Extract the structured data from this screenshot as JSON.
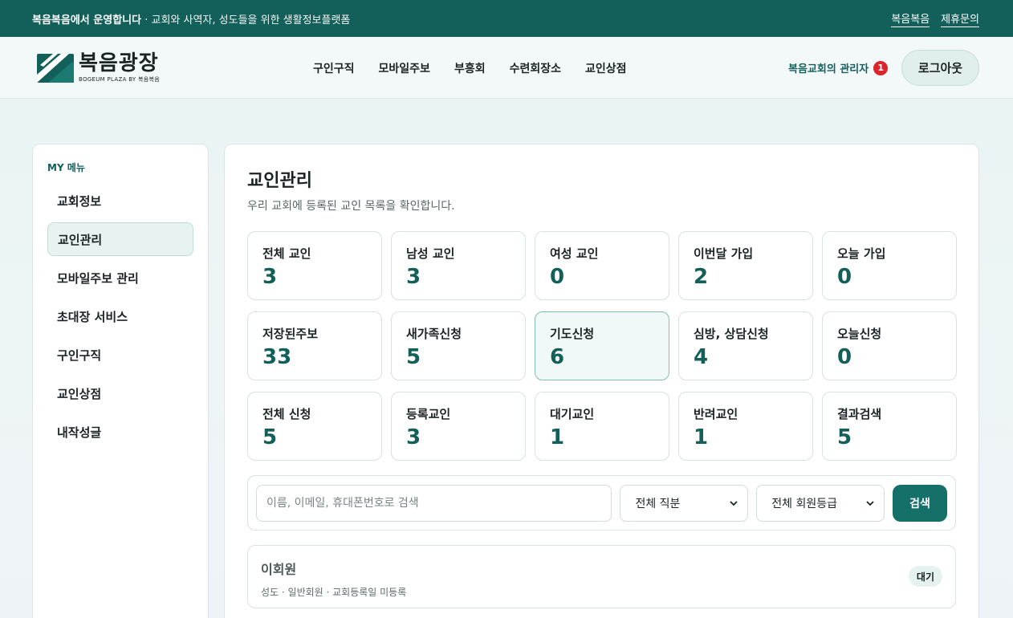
{
  "topbar": {
    "operator": "복음복음에서 운영합니다",
    "tagline": " · 교회와 사역자, 성도들을 위한 생활정보플랫폼",
    "links": [
      "복음복음",
      "제휴문의"
    ]
  },
  "header": {
    "logo_title": "복음광장",
    "logo_sub": "BOGEUM PLAZA BY 복음복음",
    "nav": [
      "구인구직",
      "모바일주보",
      "부흥회",
      "수련회장소",
      "교인상점"
    ],
    "admin_label": "복음교회의 관리자",
    "notification_count": "1",
    "logout_label": "로그아웃"
  },
  "sidebar": {
    "caption": "MY 메뉴",
    "items": [
      {
        "label": "교회정보"
      },
      {
        "label": "교인관리"
      },
      {
        "label": "모바일주보 관리"
      },
      {
        "label": "초대장 서비스"
      },
      {
        "label": "구인구직"
      },
      {
        "label": "교인상점"
      },
      {
        "label": "내작성글"
      }
    ],
    "active": "교인관리"
  },
  "main": {
    "title": "교인관리",
    "description": "우리 교회에 등록된 교인 목록을 확인합니다.",
    "stats": [
      {
        "label": "전체 교인",
        "value": "3"
      },
      {
        "label": "남성 교인",
        "value": "3"
      },
      {
        "label": "여성 교인",
        "value": "0"
      },
      {
        "label": "이번달 가입",
        "value": "2"
      },
      {
        "label": "오늘 가입",
        "value": "0"
      },
      {
        "label": "저장된주보",
        "value": "33"
      },
      {
        "label": "새가족신청",
        "value": "5"
      },
      {
        "label": "기도신청",
        "value": "6"
      },
      {
        "label": "심방, 상담신청",
        "value": "4"
      },
      {
        "label": "오늘신청",
        "value": "0"
      },
      {
        "label": "전체 신청",
        "value": "5"
      },
      {
        "label": "등록교인",
        "value": "3"
      },
      {
        "label": "대기교인",
        "value": "1"
      },
      {
        "label": "반려교인",
        "value": "1"
      },
      {
        "label": "결과검색",
        "value": "5"
      }
    ],
    "search": {
      "placeholder": "이름, 이메일, 휴대폰번호로 검색",
      "value": "",
      "role_select": "전체 직분",
      "grade_select": "전체 회원등급",
      "button_label": "검색"
    },
    "members": [
      {
        "name": "이회원",
        "meta": "성도 · 일반회원 · 교회등록일 미등록",
        "status": "대기"
      }
    ]
  },
  "colors": {
    "brand": "#135f59",
    "value_text": "#135f59",
    "notification": "#d9252b"
  }
}
